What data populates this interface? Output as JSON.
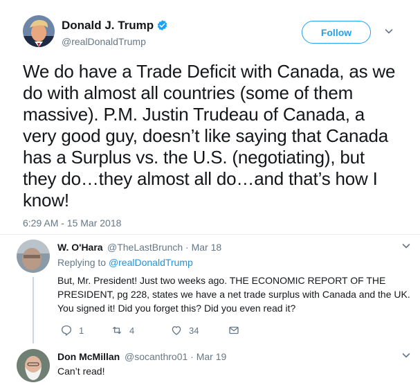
{
  "main_tweet": {
    "display_name": "Donald J. Trump",
    "handle": "@realDonaldTrump",
    "follow_label": "Follow",
    "text": "We do have a Trade Deficit with Canada, as we do with almost all countries (some of them massive). P.M. Justin Trudeau of Canada, a very good guy, doesn’t like saying that Canada has a Surplus vs. the U.S. (negotiating), but they do…they almost all do…and that’s how I know!",
    "timestamp": "6:29 AM - 15 Mar 2018"
  },
  "replies": [
    {
      "name": "W. O'Hara",
      "meta": "@TheLastBrunch · Mar 18",
      "replying_prefix": "Replying to ",
      "replying_to": "@realDonaldTrump",
      "text": "But, Mr. President! Just two weeks ago. THE ECONOMIC REPORT OF THE PRESIDENT, pg 228, states we have a net trade surplus with Canada and the UK. You signed it! Did you forget this? Did you even read it?",
      "replies_count": "1",
      "retweets_count": "4",
      "likes_count": "34"
    },
    {
      "name": "Don McMillan",
      "meta": "@socanthro01 · Mar 19",
      "text": "Can’t read!"
    }
  ],
  "colors": {
    "twitter_blue": "#1da1f2",
    "link_blue": "#1b95e0",
    "muted": "#657786",
    "text": "#14171a"
  }
}
